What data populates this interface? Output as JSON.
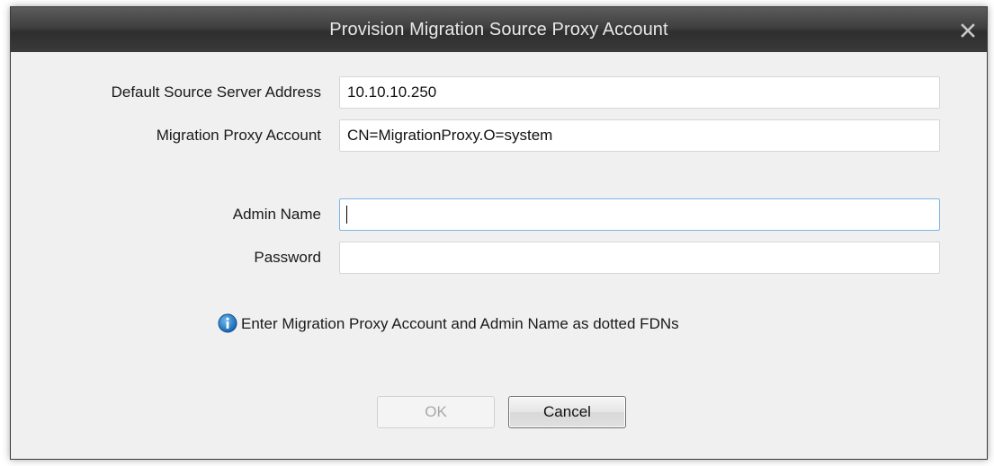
{
  "window": {
    "title": "Provision Migration Source Proxy Account",
    "close_icon": "close-icon"
  },
  "form": {
    "source_server": {
      "label": "Default Source Server Address",
      "value": "10.10.10.250"
    },
    "proxy_account": {
      "label": "Migration Proxy Account",
      "value": "CN=MigrationProxy.O=system"
    },
    "admin_name": {
      "label": "Admin Name",
      "value": ""
    },
    "password": {
      "label": "Password",
      "value": ""
    }
  },
  "info": {
    "icon": "info-icon",
    "text": "Enter Migration Proxy Account and Admin Name as dotted FDNs"
  },
  "buttons": {
    "ok_label": "OK",
    "ok_enabled": false,
    "cancel_label": "Cancel"
  },
  "colors": {
    "titlebar": "#3f3f3f",
    "dialog_bg": "#f0f0f0",
    "focus_border": "#7eb4ea",
    "info_icon": "#1e7fc8"
  }
}
